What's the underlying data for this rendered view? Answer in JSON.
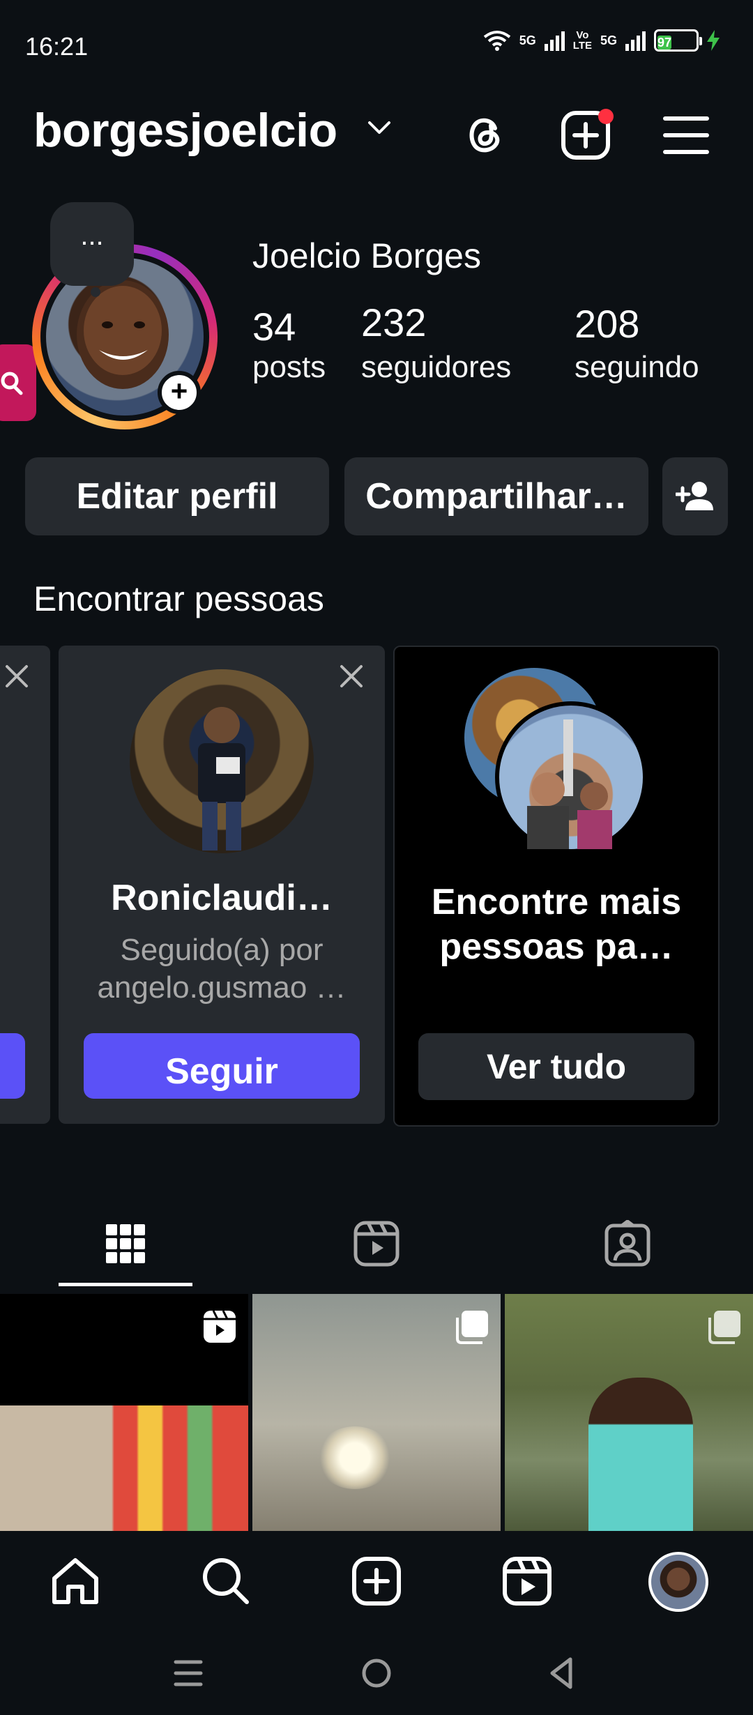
{
  "status_bar": {
    "time": "16:21",
    "network_1": "5G",
    "volte": "Vo\nLTE",
    "network_2": "5G",
    "battery": "97"
  },
  "header": {
    "username": "borgesjoelcio"
  },
  "profile": {
    "note": "...",
    "display_name": "Joelcio Borges",
    "stats": {
      "posts_count": "34",
      "posts_label": "posts",
      "followers_count": "232",
      "followers_label": "seguidores",
      "following_count": "208",
      "following_label": "seguindo"
    },
    "edit_label": "Editar perfil",
    "share_label": "Compartilhar…"
  },
  "discover": {
    "title": "Encontrar pessoas",
    "cards": [
      {
        "name": "Roniclaudi…",
        "subtitle_line1": "Seguido(a) por",
        "subtitle_line2": "angelo.gusmao …",
        "button": "Seguir"
      },
      {
        "text": "Encontre mais pessoas pa…",
        "button": "Ver tudo"
      }
    ]
  },
  "colors": {
    "background": "#0c1014",
    "surface": "#262a2f",
    "accent": "#5b51f7",
    "notification": "#ff3040"
  },
  "icons": {
    "threads": "threads-icon",
    "new_post": "plus-square-icon",
    "menu": "hamburger-menu-icon",
    "add_person": "add-person-icon",
    "grid": "grid-icon",
    "reels": "reels-icon",
    "tagged": "tagged-icon",
    "home": "home-icon",
    "search": "search-icon"
  }
}
